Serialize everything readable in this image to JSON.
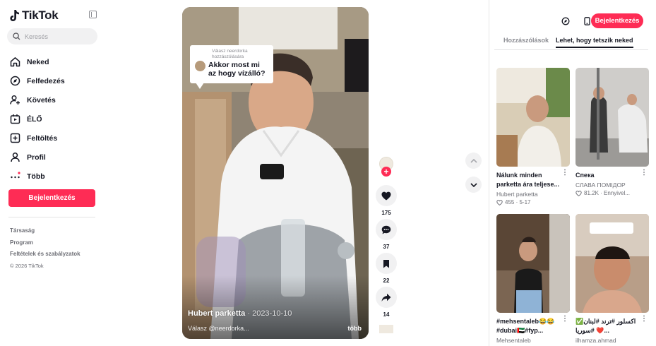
{
  "app": {
    "name": "TikTok"
  },
  "search": {
    "placeholder": "Keresés"
  },
  "nav": {
    "items": [
      {
        "label": "Neked",
        "icon": "home-icon"
      },
      {
        "label": "Felfedezés",
        "icon": "compass-icon"
      },
      {
        "label": "Követés",
        "icon": "following-icon"
      },
      {
        "label": "ÉLŐ",
        "icon": "live-icon"
      },
      {
        "label": "Feltöltés",
        "icon": "upload-icon"
      },
      {
        "label": "Profil",
        "icon": "profile-icon"
      },
      {
        "label": "Több",
        "icon": "more-icon"
      }
    ]
  },
  "sidebar": {
    "login_label": "Bejelentkezés",
    "footer_links": [
      "Társaság",
      "Program",
      "Feltételek és szabályzatok"
    ],
    "copyright": "© 2026 TikTok"
  },
  "video": {
    "reply_header": "Válasz neerdorka hozzászólására",
    "reply_text": "Akkor most mi az hogy vízálló?",
    "author": "Hubert parketta",
    "date": "· 2023-10-10",
    "description": "Válasz @neerdorka...",
    "more_label": "több"
  },
  "actions": {
    "likes": "175",
    "comments": "37",
    "saves": "22",
    "shares": "14"
  },
  "header": {
    "login_label": "Bejelentkezés"
  },
  "tabs": [
    {
      "label": "Hozzászólások",
      "active": false
    },
    {
      "label": "Lehet, hogy tetszik neked",
      "active": true
    }
  ],
  "cards": [
    {
      "title": "Nálunk minden parketta ára teljese...",
      "author": "Hubert parketta",
      "meta": "455 · 5-17",
      "bg": "#c9b99a"
    },
    {
      "title": "Спека",
      "author": "СЛАВА ПОМІДОР",
      "meta": "81.2K · Ennyivel...",
      "bg": "#bfbcb8"
    },
    {
      "title": "#mehsentaleb😂😂 #dubai🇦🇪#fyp...",
      "author": "Mehsentaleb",
      "meta": "",
      "bg": "#6f5a48"
    },
    {
      "title": "اكسلور #ترند #لبنان✅❤️ #سوريا...",
      "author": "ilhamza.ahmad",
      "meta": "",
      "bg": "#b08066"
    }
  ],
  "colors": {
    "accent": "#fe2c55",
    "text": "#161823",
    "muted": "#8a8b91"
  }
}
